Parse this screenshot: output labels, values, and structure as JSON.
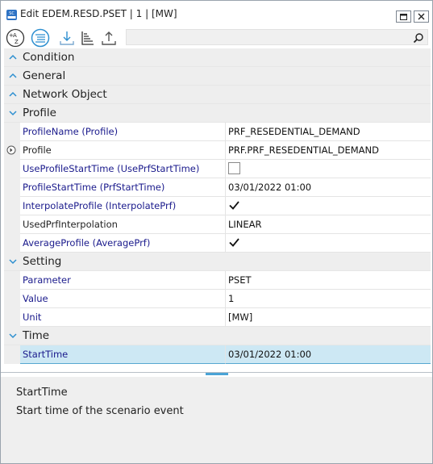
{
  "window": {
    "title": "Edit EDEM.RESD.PSET | 1 | [MW]",
    "app_icon": "sc-app-icon",
    "controls": [
      "maximize-icon",
      "close-icon"
    ]
  },
  "toolbar": {
    "buttons": [
      {
        "name": "sort-alphabetical-icon"
      },
      {
        "name": "categorized-view-icon",
        "active": true
      },
      {
        "name": "import-icon"
      },
      {
        "name": "sort-by-level-icon"
      },
      {
        "name": "export-icon"
      }
    ],
    "search_placeholder": "",
    "search_icon": "magnifier-icon"
  },
  "grid": {
    "categories": {
      "condition": "Condition",
      "general": "General",
      "network_object": "Network Object",
      "profile": "Profile",
      "setting": "Setting",
      "time": "Time"
    },
    "profile_rows": [
      {
        "name": "ProfileName (Profile)",
        "value": "PRF_RESEDENTIAL_DEMAND"
      },
      {
        "name": "Profile",
        "value": "PRF.PRF_RESEDENTIAL_DEMAND"
      },
      {
        "name": "UseProfileStartTime (UsePrfStartTime)",
        "value": ""
      },
      {
        "name": "ProfileStartTime (PrfStartTime)",
        "value": "03/01/2022 01:00"
      },
      {
        "name": "InterpolateProfile (InterpolatePrf)",
        "value": ""
      },
      {
        "name": "UsedPrfInterpolation",
        "value": "LINEAR"
      },
      {
        "name": "AverageProfile (AveragePrf)",
        "value": ""
      }
    ],
    "checkbox_states": {
      "use_profile_start_time": false,
      "interpolate_profile": true,
      "average_profile": true
    },
    "setting_rows": [
      {
        "name": "Parameter",
        "value": "PSET"
      },
      {
        "name": "Value",
        "value": "1"
      },
      {
        "name": "Unit",
        "value": "[MW]"
      }
    ],
    "time_rows": [
      {
        "name": "StartTime",
        "value": "03/01/2022 01:00"
      }
    ]
  },
  "description": {
    "title": "StartTime",
    "text": "Start time of the scenario event"
  },
  "colors": {
    "accent": "#2d8fd0",
    "chevron": "#2d8fd0",
    "name_text": "#1a1a8c",
    "selection": "#cde8f4"
  }
}
